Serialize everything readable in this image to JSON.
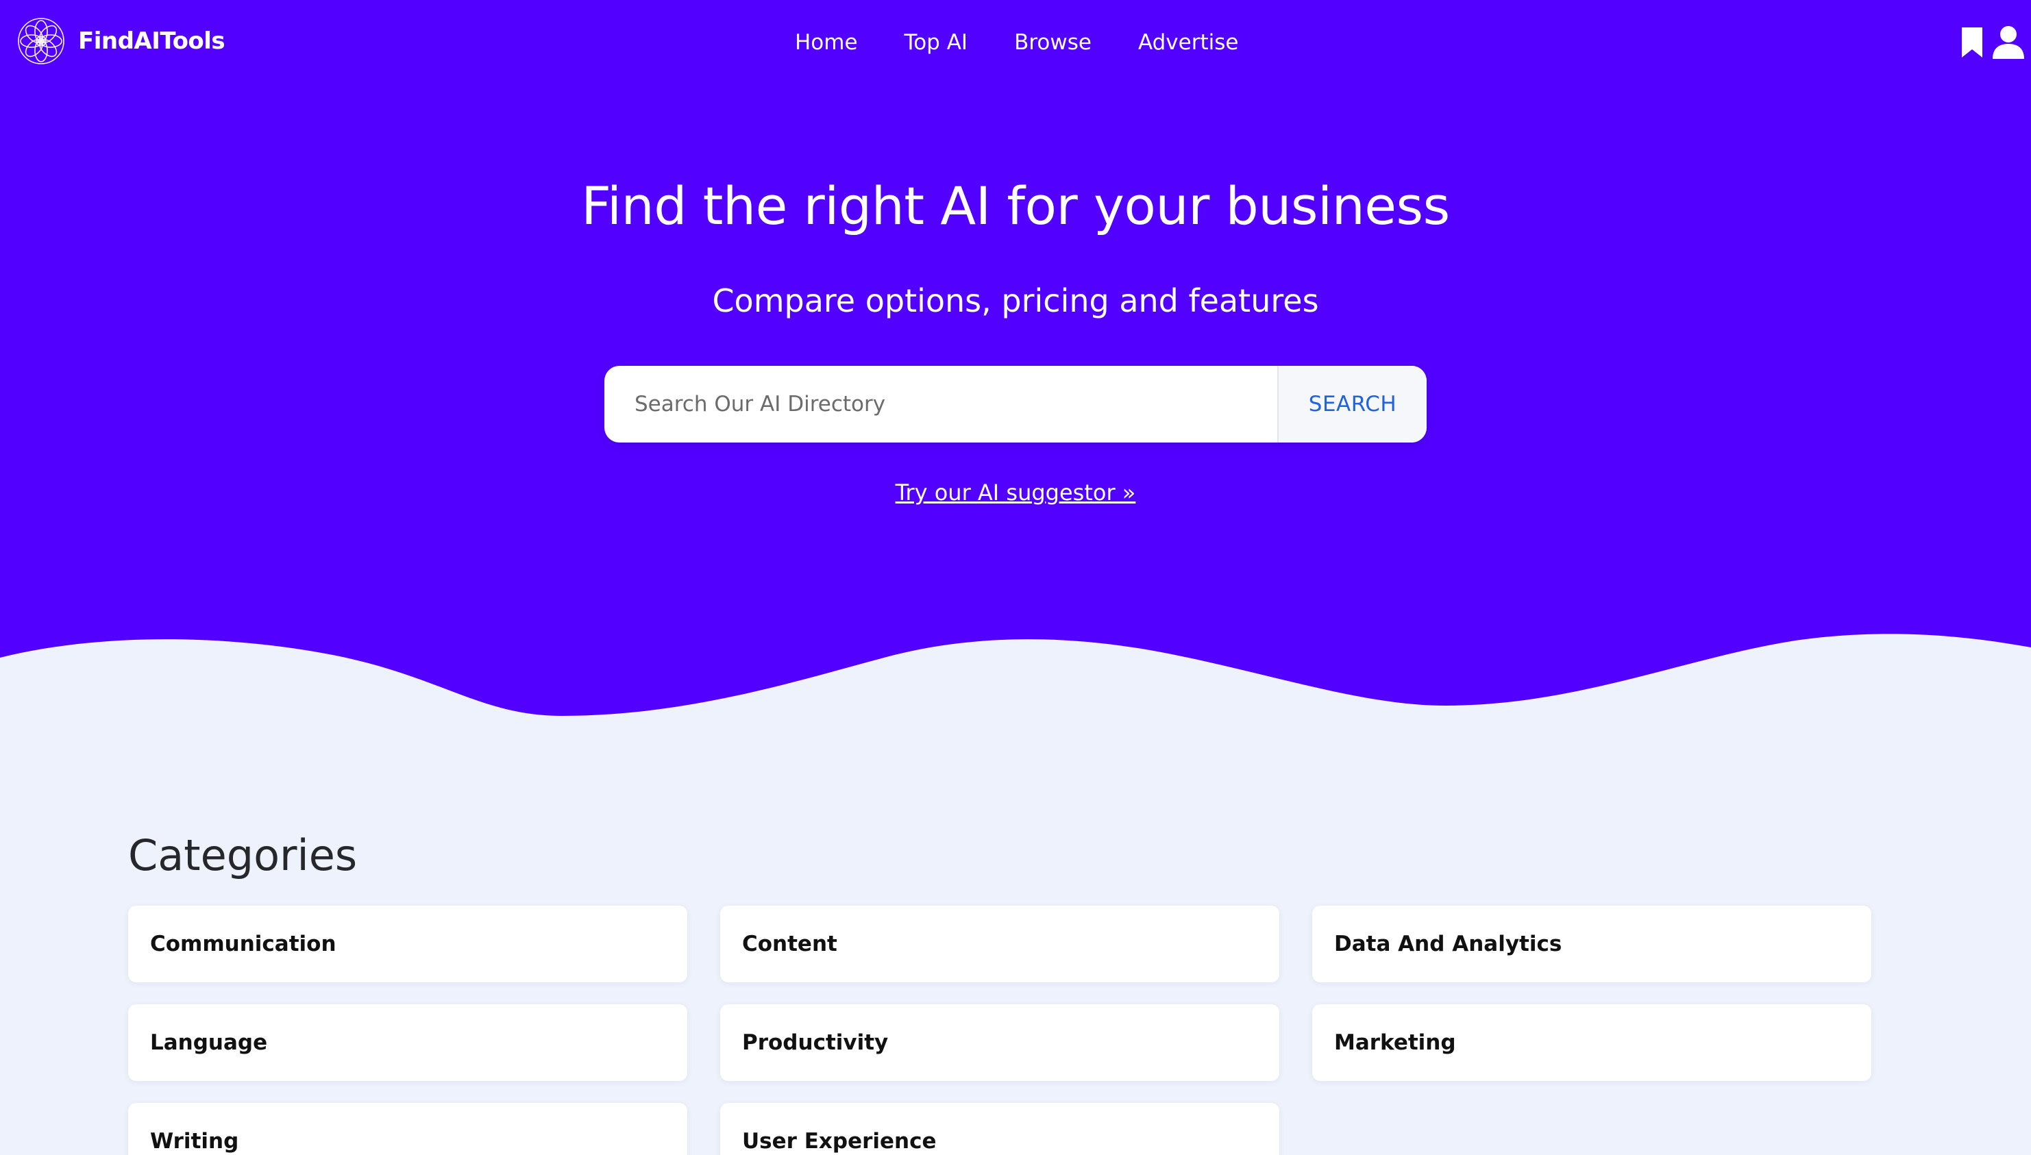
{
  "colors": {
    "hero_background": "#5200ff",
    "page_background": "#eef2fc",
    "search_button_text": "#1f63e0",
    "card_background": "#ffffff"
  },
  "navbar": {
    "brand_name": "FindAITools",
    "logo_icon": "flower-logo-icon",
    "links": [
      {
        "label": "Home"
      },
      {
        "label": "Top AI"
      },
      {
        "label": "Browse"
      },
      {
        "label": "Advertise"
      }
    ],
    "icons": [
      "bookmark-icon",
      "user-icon"
    ]
  },
  "hero": {
    "title": "Find the right AI for your business",
    "subtitle": "Compare options, pricing and features",
    "search": {
      "placeholder": "Search Our AI Directory",
      "value": "",
      "button_label": "SEARCH"
    },
    "suggestor_link": "Try our AI suggestor »"
  },
  "categories": {
    "heading": "Categories",
    "items": [
      {
        "label": "Communication"
      },
      {
        "label": "Content"
      },
      {
        "label": "Data And Analytics"
      },
      {
        "label": "Language"
      },
      {
        "label": "Productivity"
      },
      {
        "label": "Marketing"
      },
      {
        "label": "Writing"
      },
      {
        "label": "User Experience"
      }
    ]
  }
}
